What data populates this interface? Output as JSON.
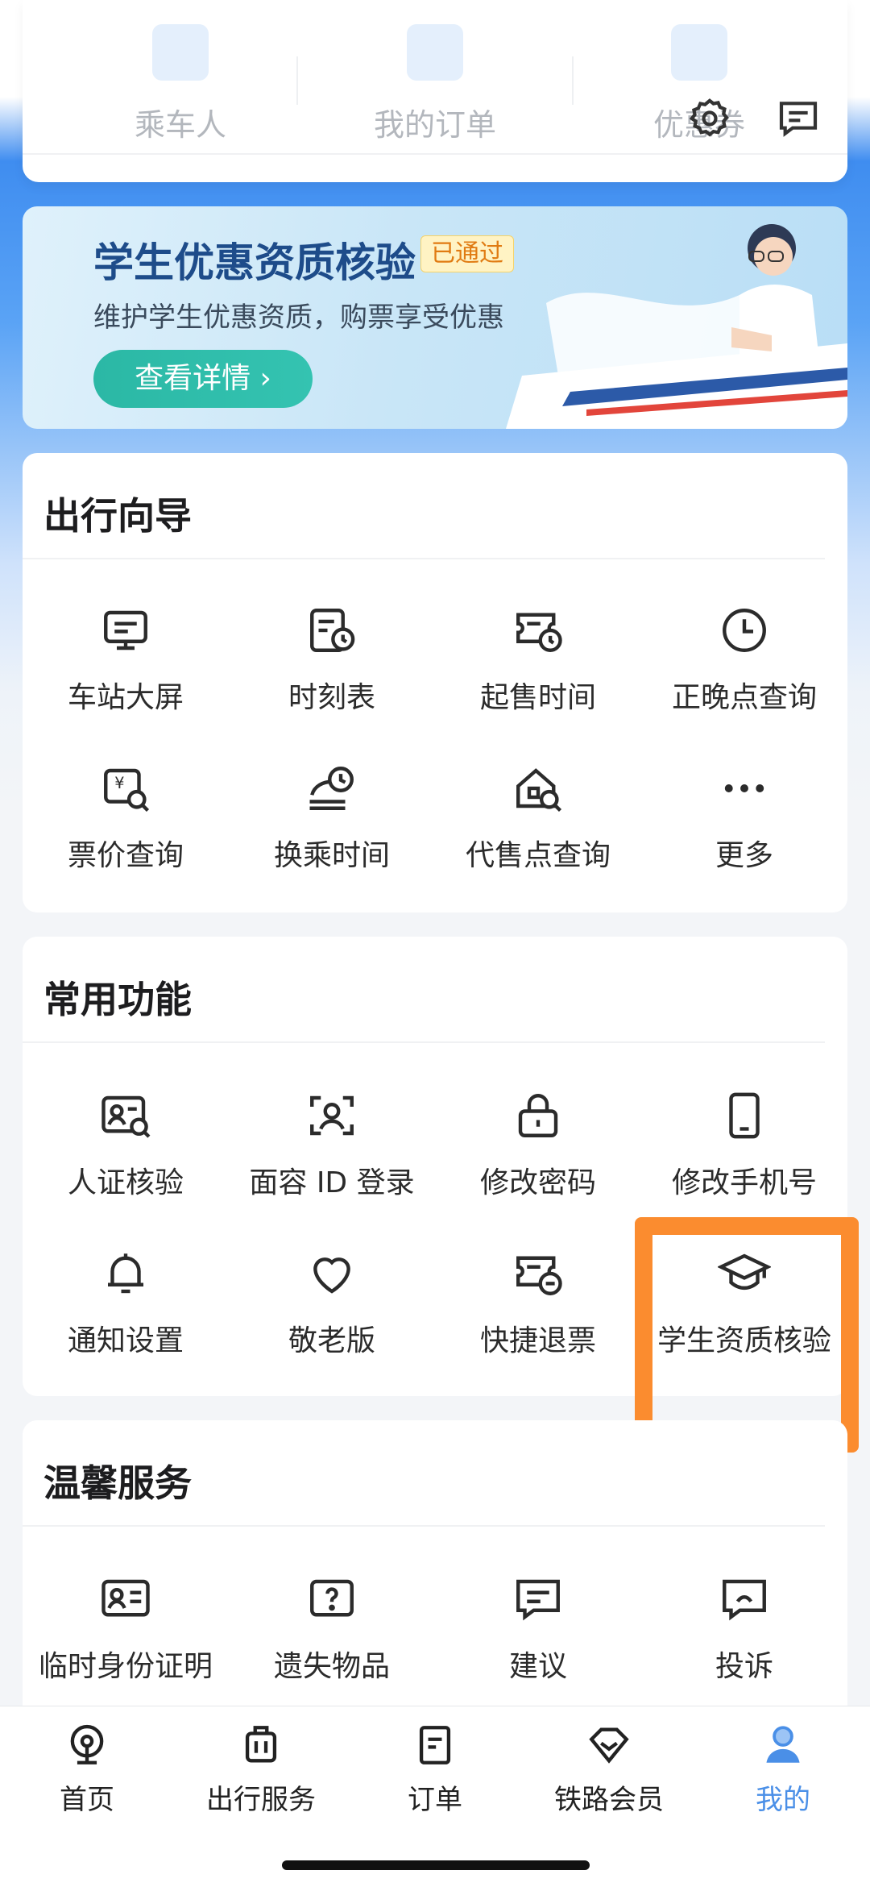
{
  "top_shortcuts": [
    {
      "label": "乘车人",
      "icon": "passenger-icon"
    },
    {
      "label": "我的订单",
      "icon": "order-icon"
    },
    {
      "label": "优惠券",
      "icon": "coupon-icon"
    }
  ],
  "header_icons": [
    "settings-icon",
    "message-icon"
  ],
  "banner": {
    "title": "学生优惠资质核验",
    "badge": "已通过",
    "subtitle": "维护学生优惠资质，购票享受优惠",
    "button": "查看详情 ›"
  },
  "travel_guide": {
    "title": "出行向导",
    "items": [
      {
        "label": "车站大屏",
        "icon": "station-screen-icon"
      },
      {
        "label": "时刻表",
        "icon": "timetable-icon"
      },
      {
        "label": "起售时间",
        "icon": "sale-time-icon"
      },
      {
        "label": "正晚点查询",
        "icon": "clock-icon"
      },
      {
        "label": "票价查询",
        "icon": "fare-search-icon"
      },
      {
        "label": "换乘时间",
        "icon": "transfer-time-icon"
      },
      {
        "label": "代售点查询",
        "icon": "agency-search-icon"
      },
      {
        "label": "更多",
        "icon": "more-icon"
      }
    ]
  },
  "common_functions": {
    "title": "常用功能",
    "items": [
      {
        "label": "人证核验",
        "icon": "id-verify-icon"
      },
      {
        "label": "面容 ID 登录",
        "icon": "face-id-icon"
      },
      {
        "label": "修改密码",
        "icon": "lock-icon"
      },
      {
        "label": "修改手机号",
        "icon": "phone-icon"
      },
      {
        "label": "通知设置",
        "icon": "bell-icon"
      },
      {
        "label": "敬老版",
        "icon": "heart-icon"
      },
      {
        "label": "快捷退票",
        "icon": "refund-ticket-icon"
      },
      {
        "label": "学生资质核验",
        "icon": "graduation-cap-icon"
      }
    ]
  },
  "warm_services": {
    "title": "温馨服务",
    "items": [
      {
        "label": "临时身份证明",
        "icon": "temp-id-icon"
      },
      {
        "label": "遗失物品",
        "icon": "lost-item-icon"
      },
      {
        "label": "建议",
        "icon": "suggestion-icon"
      },
      {
        "label": "投诉",
        "icon": "complaint-icon"
      }
    ]
  },
  "bottom_nav": [
    {
      "label": "首页",
      "icon": "home-icon",
      "active": false
    },
    {
      "label": "出行服务",
      "icon": "luggage-icon",
      "active": false
    },
    {
      "label": "订单",
      "icon": "order-list-icon",
      "active": false
    },
    {
      "label": "铁路会员",
      "icon": "diamond-icon",
      "active": false
    },
    {
      "label": "我的",
      "icon": "user-icon",
      "active": true
    }
  ],
  "colors": {
    "accent": "#4a8fe7",
    "highlight": "#fb8c2f",
    "banner_button": "#2bb8a5"
  }
}
